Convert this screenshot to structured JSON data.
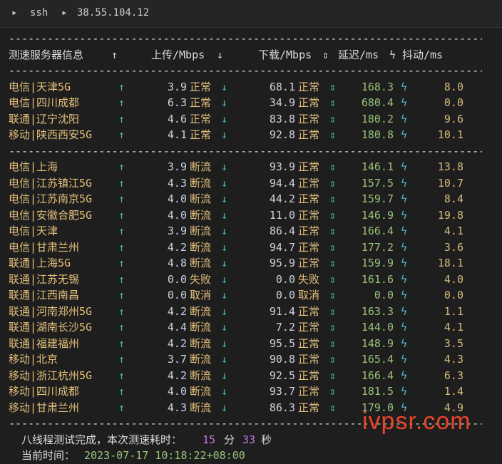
{
  "tabbar": {
    "prefix": "▸",
    "cmd": "ssh",
    "sep": "▸",
    "host": "38.55.104.12"
  },
  "separator_dash": "------------------------------------------------------------------------",
  "separator_long": "-----------------------------------------------------------------------------------------------------------",
  "header": {
    "node": "测速服务器信息",
    "up_arrow": "↑",
    "upload": "上传/Mbps",
    "down_arrow": "↓",
    "download": "下载/Mbps",
    "updown_arrow": "⇕",
    "latency": "延迟/ms",
    "bolt": "ϟ",
    "jitter": "抖动/ms"
  },
  "groups": [
    [
      {
        "node": "电信|天津5G",
        "up": "3.9",
        "up_status": "正常",
        "down": "68.1",
        "down_status": "正常",
        "latency": "168.3",
        "jitter": "8.0"
      },
      {
        "node": "电信|四川成都",
        "up": "6.3",
        "up_status": "正常",
        "down": "34.9",
        "down_status": "正常",
        "latency": "680.4",
        "jitter": "0.0"
      },
      {
        "node": "联通|辽宁沈阳",
        "up": "4.6",
        "up_status": "正常",
        "down": "83.8",
        "down_status": "正常",
        "latency": "180.2",
        "jitter": "9.6"
      },
      {
        "node": "移动|陕西西安5G",
        "up": "4.1",
        "up_status": "正常",
        "down": "92.8",
        "down_status": "正常",
        "latency": "180.8",
        "jitter": "10.1"
      }
    ],
    [
      {
        "node": "电信|上海",
        "up": "3.9",
        "up_status": "断流",
        "down": "93.9",
        "down_status": "正常",
        "latency": "146.1",
        "jitter": "13.8"
      },
      {
        "node": "电信|江苏镇江5G",
        "up": "4.3",
        "up_status": "断流",
        "down": "94.4",
        "down_status": "正常",
        "latency": "157.5",
        "jitter": "10.7"
      },
      {
        "node": "电信|江苏南京5G",
        "up": "4.0",
        "up_status": "断流",
        "down": "44.2",
        "down_status": "正常",
        "latency": "159.7",
        "jitter": "8.4"
      },
      {
        "node": "电信|安徽合肥5G",
        "up": "4.0",
        "up_status": "断流",
        "down": "11.0",
        "down_status": "正常",
        "latency": "146.9",
        "jitter": "19.8"
      },
      {
        "node": "电信|天津",
        "up": "3.9",
        "up_status": "断流",
        "down": "86.4",
        "down_status": "正常",
        "latency": "166.4",
        "jitter": "4.1"
      },
      {
        "node": "电信|甘肃兰州",
        "up": "4.2",
        "up_status": "断流",
        "down": "94.7",
        "down_status": "正常",
        "latency": "177.2",
        "jitter": "3.6"
      },
      {
        "node": "联通|上海5G",
        "up": "4.8",
        "up_status": "断流",
        "down": "95.9",
        "down_status": "正常",
        "latency": "159.9",
        "jitter": "18.1"
      },
      {
        "node": "联通|江苏无锡",
        "up": "0.0",
        "up_status": "失败",
        "down": "0.0",
        "down_status": "失败",
        "latency": "161.6",
        "jitter": "4.0"
      },
      {
        "node": "联通|江西南昌",
        "up": "0.0",
        "up_status": "取消",
        "down": "0.0",
        "down_status": "取消",
        "latency": "0.0",
        "jitter": "0.0"
      },
      {
        "node": "联通|河南郑州5G",
        "up": "4.2",
        "up_status": "断流",
        "down": "91.4",
        "down_status": "正常",
        "latency": "163.3",
        "jitter": "1.1"
      },
      {
        "node": "联通|湖南长沙5G",
        "up": "4.4",
        "up_status": "断流",
        "down": "7.2",
        "down_status": "正常",
        "latency": "144.0",
        "jitter": "4.1"
      },
      {
        "node": "联通|福建福州",
        "up": "4.2",
        "up_status": "断流",
        "down": "95.5",
        "down_status": "正常",
        "latency": "148.9",
        "jitter": "3.5"
      },
      {
        "node": "移动|北京",
        "up": "3.7",
        "up_status": "断流",
        "down": "90.8",
        "down_status": "正常",
        "latency": "165.4",
        "jitter": "4.3"
      },
      {
        "node": "移动|浙江杭州5G",
        "up": "4.2",
        "up_status": "断流",
        "down": "92.5",
        "down_status": "正常",
        "latency": "166.4",
        "jitter": "6.3"
      },
      {
        "node": "移动|四川成都",
        "up": "4.0",
        "up_status": "断流",
        "down": "93.7",
        "down_status": "正常",
        "latency": "181.5",
        "jitter": "1.4"
      },
      {
        "node": "移动|甘肃兰州",
        "up": "4.3",
        "up_status": "断流",
        "down": "86.3",
        "down_status": "正常",
        "latency": "179.0",
        "jitter": "4.9"
      }
    ]
  ],
  "footer": {
    "done_text": "八线程测试完成，本次测速耗时：",
    "minutes": "15",
    "min_unit": "分",
    "seconds": "33",
    "sec_unit": "秒",
    "time_label": "当前时间：",
    "time_value": "2023-07-17 10:18:22+08:00"
  },
  "watermark": "ivpsr.com",
  "colors": {
    "node": "#e5c07b",
    "arrow": "#56b6c2",
    "latency": "#98c379",
    "jitter": "#d7ba7d",
    "footer_num": "#c678dd"
  }
}
